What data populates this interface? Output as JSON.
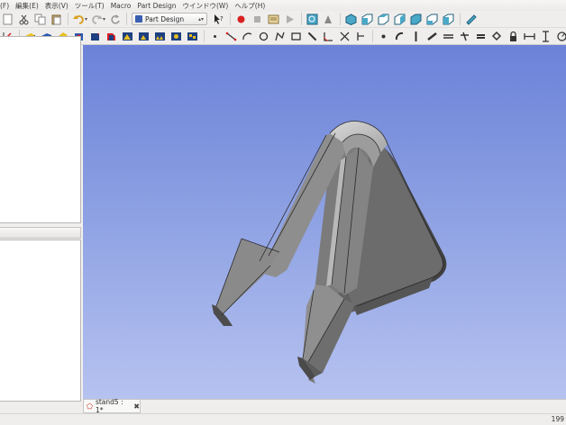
{
  "menu": [
    "(F)",
    "編集(E)",
    "表示(V)",
    "ツール(T)",
    "Macro",
    "Part Design",
    "ウインドウ(W)",
    "ヘルプ(H)"
  ],
  "toolbar": {
    "workbench": "Part Design"
  },
  "document_tab": {
    "label": "stand5 : 1*"
  },
  "status": {
    "coords": "199"
  },
  "colors": {
    "viewport_top": "#6b82d8",
    "viewport_bottom": "#b6c2f0",
    "model_face": "#8a8a8a",
    "model_dark": "#4a4a4a"
  }
}
